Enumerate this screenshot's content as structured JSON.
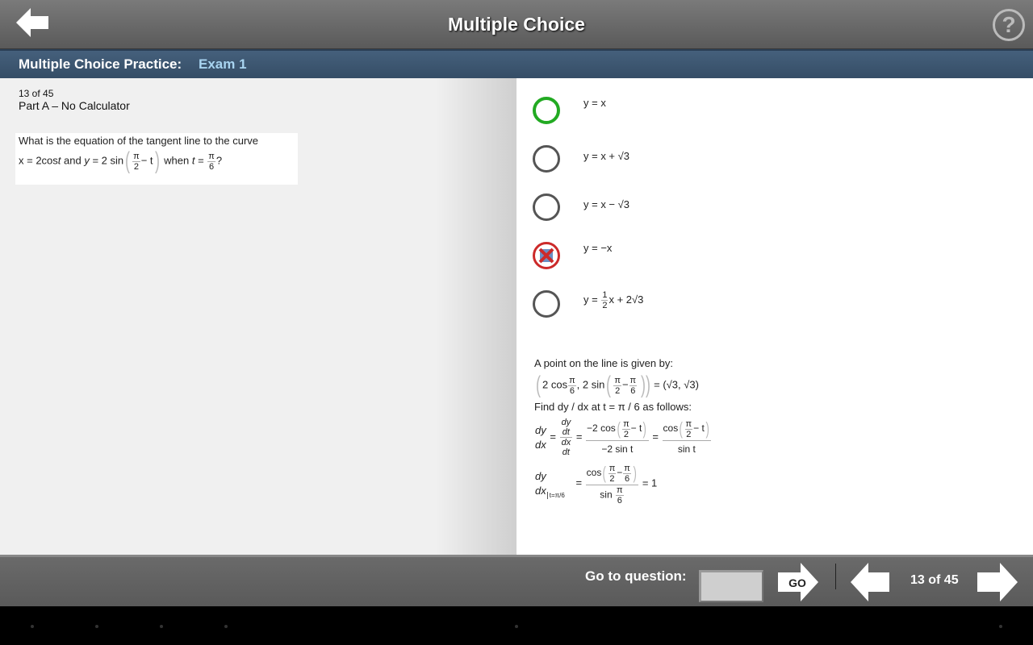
{
  "header": {
    "title": "Multiple Choice",
    "back_icon": "arrow-left-icon",
    "help_label": "?"
  },
  "subheader": {
    "prefix": "Multiple Choice Practice:",
    "exam": "Exam 1",
    "exam_color": "#a8d4f0"
  },
  "question": {
    "counter": "13 of 45",
    "part": "Part A – No Calculator",
    "line1": "What is the equation of the tangent line to the curve",
    "l2_a": "x = 2cos",
    "l2_t": "t",
    "l2_b": " and ",
    "l2_y": "y",
    "l2_c": " = 2 sin",
    "pi": "π",
    "two": "2",
    "six": "6",
    "minus_t": "− t",
    "when": " when ",
    "t": "t",
    "eq": " = ",
    "q": "?"
  },
  "options": [
    {
      "text": "y = x",
      "state": "correct",
      "color": "#22aa22"
    },
    {
      "text": "y = x + √3",
      "state": "unselected"
    },
    {
      "text": "y = x − √3",
      "state": "unselected"
    },
    {
      "text": "y = −x",
      "state": "wrong",
      "color": "#cc2a2a"
    },
    {
      "pre": "y = ",
      "num": "1",
      "den": "2",
      "post": "x + 2√3",
      "state": "unselected"
    }
  ],
  "solution": {
    "intro": "A point on the line is given by:",
    "p_a": "2 cos",
    "p_b": ", 2 sin",
    "p_res": "= (√3, √3)",
    "find": "Find dy / dx at t = π / 6 as follows:",
    "dy": "dy",
    "dx": "dx",
    "dt": "dt",
    "eq": "=",
    "m2cos": "−2 cos",
    "m2sin": "−2 sin t",
    "cos": "cos",
    "sint": "sin t",
    "minus_t": "− t",
    "minus": "−",
    "sin": "sin",
    "at": "t=π/6",
    "one": "= 1"
  },
  "footer": {
    "go_label": "Go to question:",
    "go_value": "",
    "go_button": "GO",
    "counter": "13 of 45",
    "prev_icon": "arrow-left-icon",
    "next_icon": "arrow-right-icon"
  }
}
